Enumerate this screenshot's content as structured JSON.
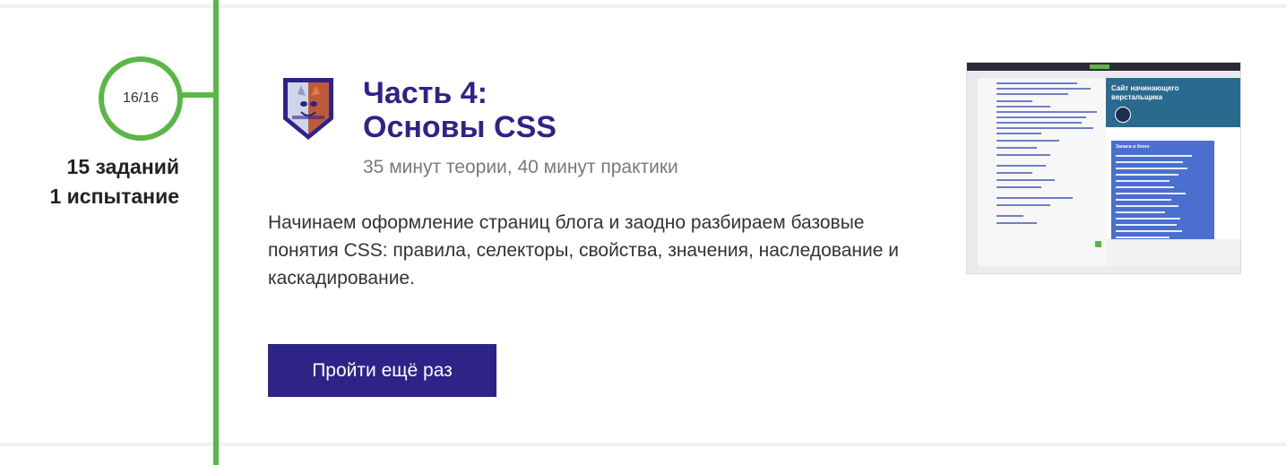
{
  "progress": {
    "label": "16/16"
  },
  "stats": {
    "tasks": "15 заданий",
    "trials": "1 испытание"
  },
  "course": {
    "title_line1": "Часть 4:",
    "title_line2": "Основы CSS",
    "duration": "35 минут теории, 40 минут практики",
    "description": "Начинаем оформление страниц блога и заодно разбираем базовые понятия CSS: правила, селекторы, свойства, значения, наследование и каскадирование.",
    "retry_label": "Пройти ещё раз"
  },
  "preview": {
    "header_title": "Сайт начинающего верстальщика",
    "card_title": "Записи в блоге"
  },
  "colors": {
    "accent_green": "#5ab747",
    "brand_purple": "#2e2387"
  }
}
